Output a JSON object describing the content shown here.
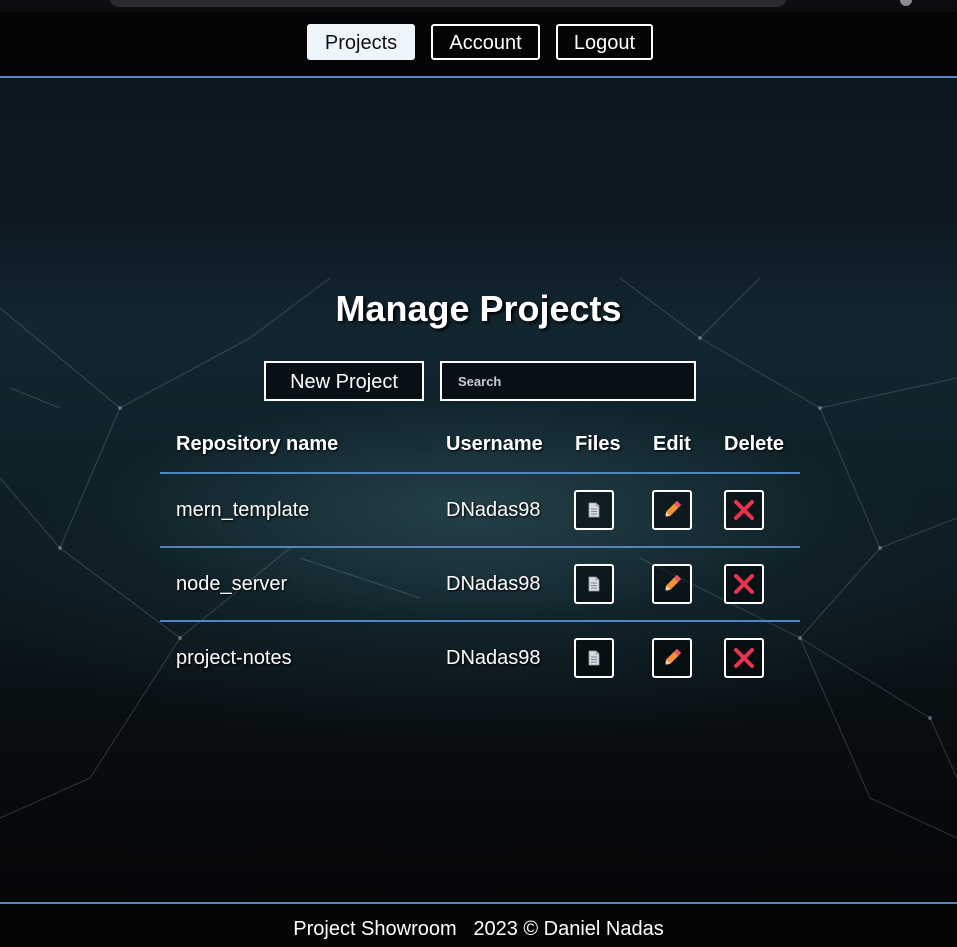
{
  "nav": {
    "items": [
      {
        "label": "Projects",
        "active": true
      },
      {
        "label": "Account",
        "active": false
      },
      {
        "label": "Logout",
        "active": false
      }
    ]
  },
  "main": {
    "title": "Manage Projects",
    "new_project_label": "New Project",
    "search_placeholder": "Search",
    "search_value": ""
  },
  "table": {
    "headers": {
      "repository": "Repository name",
      "username": "Username",
      "files": "Files",
      "edit": "Edit",
      "delete": "Delete"
    },
    "rows": [
      {
        "repository": "mern_template",
        "username": "DNadas98"
      },
      {
        "repository": "node_server",
        "username": "DNadas98"
      },
      {
        "repository": "project-notes",
        "username": "DNadas98"
      }
    ]
  },
  "icons": {
    "files": "file-icon",
    "edit": "pencil-icon",
    "delete": "cross-icon"
  },
  "colors": {
    "accent_line": "#4f86c1",
    "delete_icon": "#e8324f",
    "edit_icon": "#f4923a"
  },
  "footer": {
    "app_name": "Project Showroom",
    "copyright": "2023 © Daniel Nadas"
  }
}
